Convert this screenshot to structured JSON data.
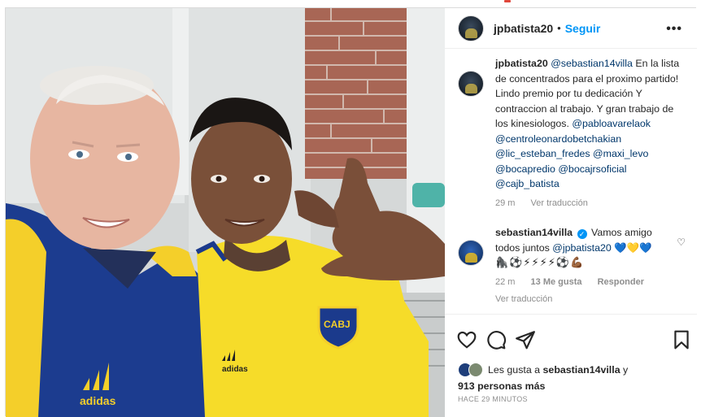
{
  "post": {
    "username": "jpbatista20",
    "separator": "•",
    "follow_label": "Seguir",
    "more_label": "•••"
  },
  "caption": {
    "username": "jpbatista20",
    "text_parts": [
      {
        "text": "@sebastian14villa",
        "mention": true
      },
      {
        "text": " En la lista de concentrados para el proximo partido! Lindo premio por tu dedicación Y contraccion al trabajo. Y gran trabajo de los kinesiologos. ",
        "mention": false
      },
      {
        "text": "@pabloavarelaok",
        "mention": true
      },
      {
        "text": " ",
        "mention": false
      },
      {
        "text": "@centroleonardobetchakian",
        "mention": true
      },
      {
        "text": " ",
        "mention": false
      },
      {
        "text": "@lic_esteban_fredes",
        "mention": true
      },
      {
        "text": " ",
        "mention": false
      },
      {
        "text": "@maxi_levo",
        "mention": true
      },
      {
        "text": " ",
        "mention": false
      },
      {
        "text": "@bocapredio",
        "mention": true
      },
      {
        "text": " ",
        "mention": false
      },
      {
        "text": "@bocajrsoficial",
        "mention": true
      },
      {
        "text": " ",
        "mention": false
      },
      {
        "text": "@cajb_batista",
        "mention": true
      }
    ],
    "time": "29 m",
    "translate_label": "Ver traducción"
  },
  "reply": {
    "username": "sebastian14villa",
    "verified_mark": "✓",
    "text": "Vamos amigo todos juntos",
    "mention": "@jpbatista20",
    "hearts": "💙💛💙",
    "emojis": "🦍⚽⚡⚡⚡⚡⚽💪🏾",
    "time": "22 m",
    "likes_label": "13 Me gusta",
    "reply_label": "Responder",
    "translate_label": "Ver traducción",
    "heart_icon": "♡"
  },
  "likes": {
    "prefix": "Les gusta a",
    "user": "sebastian14villa",
    "suffix": "y",
    "others": "913 personas más"
  },
  "timestamp": "HACE 29 MINUTOS",
  "colors": {
    "link": "#0095f6",
    "mention": "#00376b",
    "boca_blue": "#1b3a8c",
    "boca_yellow": "#f6dc29"
  }
}
